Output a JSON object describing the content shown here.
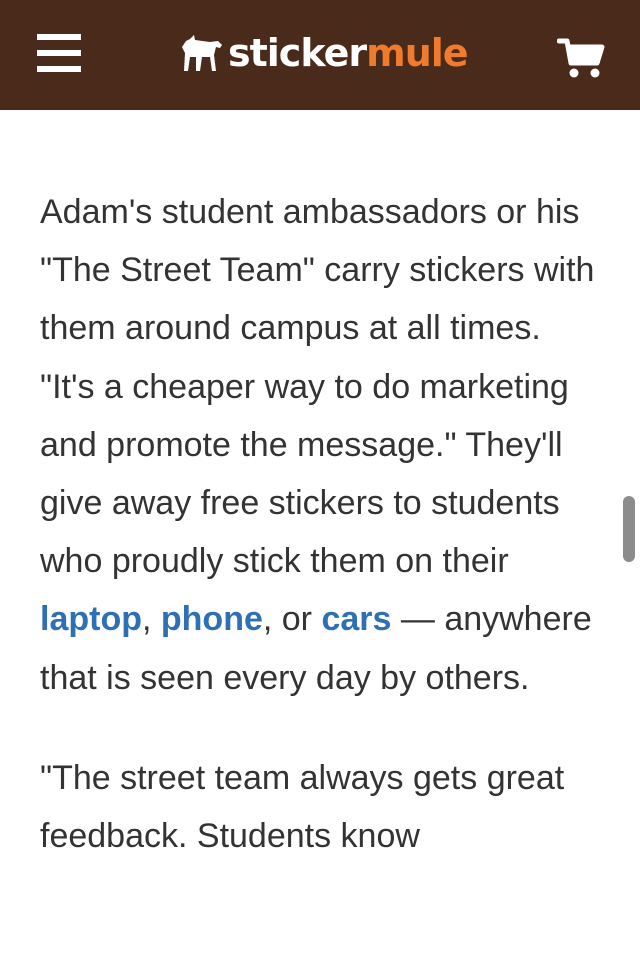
{
  "header": {
    "brand_part1": "sticker",
    "brand_part2": "mule",
    "menu_icon": "hamburger-menu-icon",
    "cart_icon": "shopping-cart-icon",
    "logo_icon": "mule-logo-icon",
    "background_color": "#4a2a1b",
    "accent_color": "#f07b2d"
  },
  "article": {
    "paragraph1": {
      "text_before": "Adam's student ambassadors or his \"The Street Team\" carry stickers with them around campus at all times. \"It's a cheaper way to do marketing and promote the message.\" They'll give away free stickers to students who proudly stick them on their ",
      "link1": "laptop",
      "sep1": ", ",
      "link2": "phone",
      "sep2": ", or ",
      "link3": "cars",
      "text_after": " — anywhere that is seen every day by others."
    },
    "paragraph2": {
      "text": "\"The street team always gets great feedback. Students know"
    },
    "link_color": "#2f70b5",
    "text_color": "#333333"
  }
}
